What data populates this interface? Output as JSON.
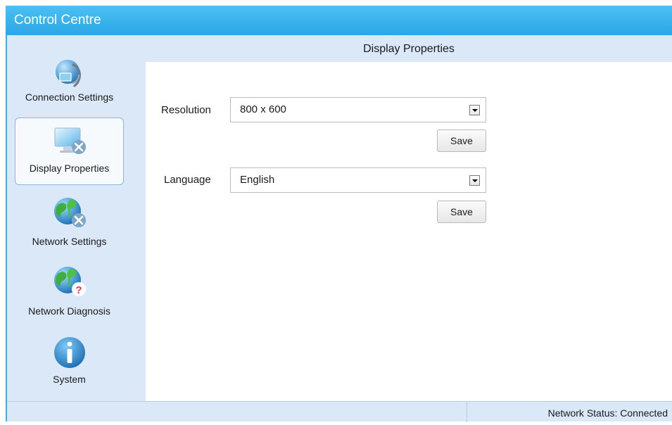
{
  "window": {
    "title": "Control Centre"
  },
  "sidebar": {
    "items": [
      {
        "label": "Connection Settings",
        "icon": "connection-settings-icon"
      },
      {
        "label": "Display Properties",
        "icon": "display-properties-icon",
        "active": true
      },
      {
        "label": "Network Settings",
        "icon": "network-settings-icon"
      },
      {
        "label": "Network Diagnosis",
        "icon": "network-diagnosis-icon"
      },
      {
        "label": "System",
        "icon": "info-icon"
      }
    ]
  },
  "panel": {
    "title": "Display Properties",
    "resolution": {
      "label": "Resolution",
      "value": "800 x 600",
      "save_label": "Save"
    },
    "language": {
      "label": "Language",
      "value": "English",
      "save_label": "Save"
    }
  },
  "status": {
    "text": "Network Status: Connected"
  },
  "colors": {
    "title_bar": "#2aa7e6",
    "sidebar_bg": "#dae8f7",
    "accent": "#3ab0ea"
  }
}
